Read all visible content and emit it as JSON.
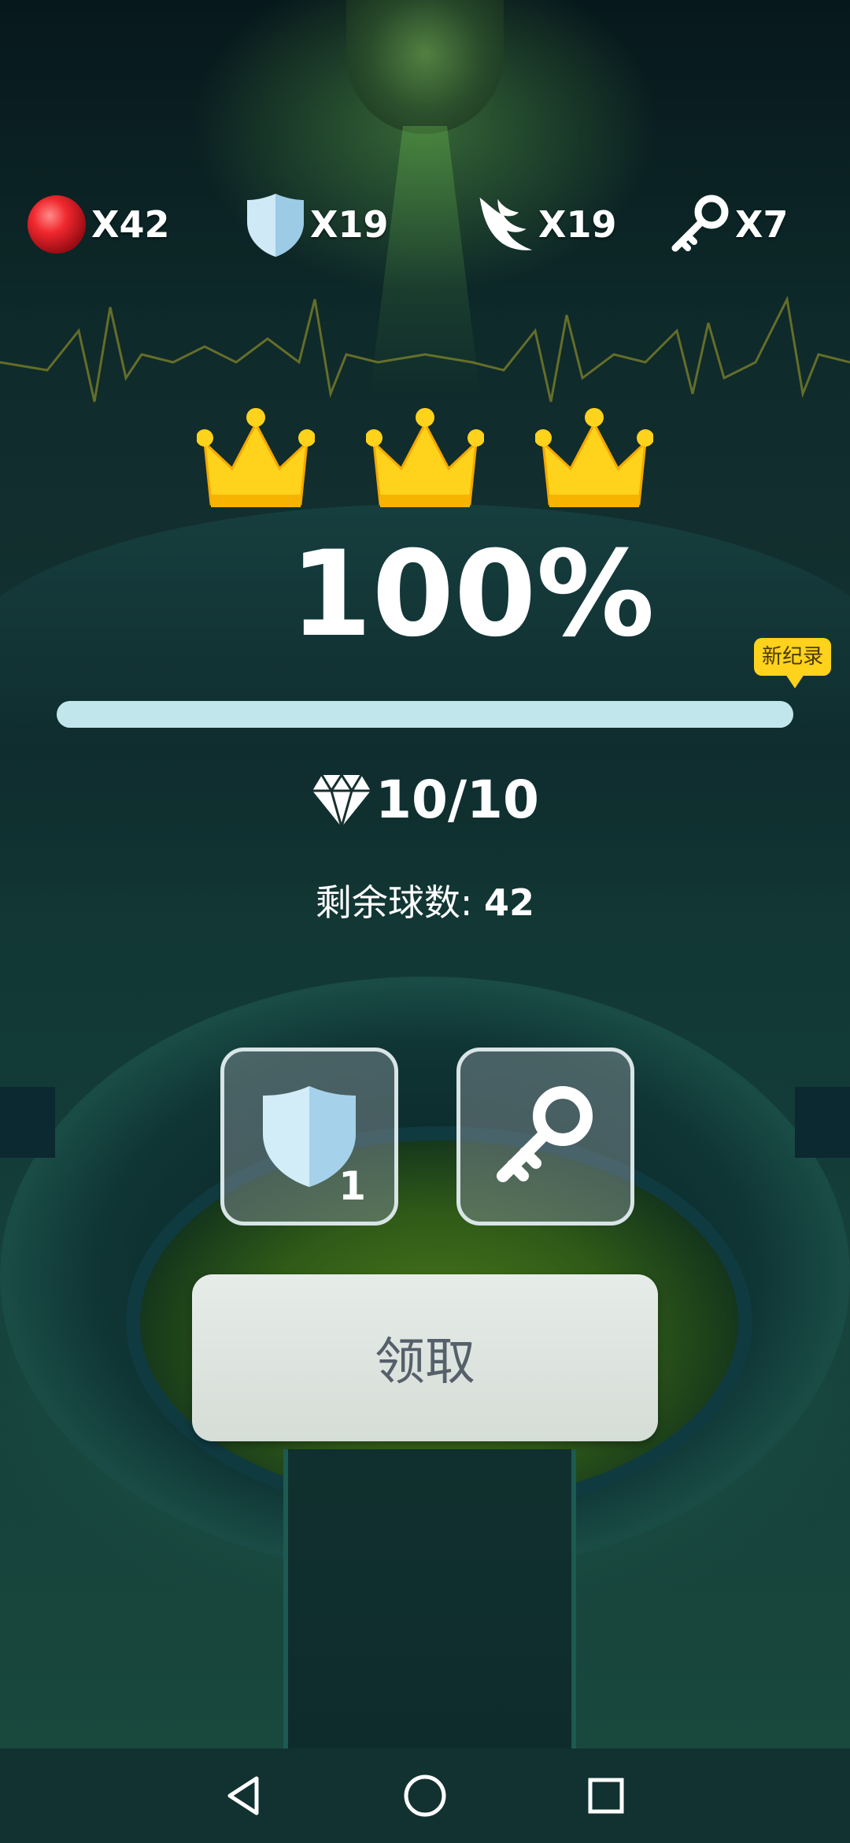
{
  "resources": {
    "ball": {
      "icon": "red-ball-icon",
      "count": "X42"
    },
    "shield": {
      "icon": "shield-icon",
      "count": "X19"
    },
    "wing": {
      "icon": "wing-icon",
      "count": "X19"
    },
    "key": {
      "icon": "key-icon",
      "count": "X7"
    }
  },
  "crowns_earned": 3,
  "progress": {
    "percent_label": "100%",
    "value_percent": 100,
    "record_badge": "新纪录"
  },
  "gems": {
    "icon": "diamond-icon",
    "count": "10/10"
  },
  "remaining_balls": {
    "label": "剩余球数:",
    "value": "42"
  },
  "powerups": {
    "shield": {
      "icon": "shield-icon",
      "count": "1"
    },
    "key": {
      "icon": "key-icon"
    }
  },
  "claim_button": {
    "label": "领取"
  },
  "colors": {
    "crown": "#ffd21c",
    "progress_bar": "#c1e6ec",
    "badge": "#ffd21c",
    "button": "#e0e6e2"
  },
  "navbar": {
    "back": "back-triangle-icon",
    "home": "home-circle-icon",
    "recent": "recent-square-icon"
  }
}
